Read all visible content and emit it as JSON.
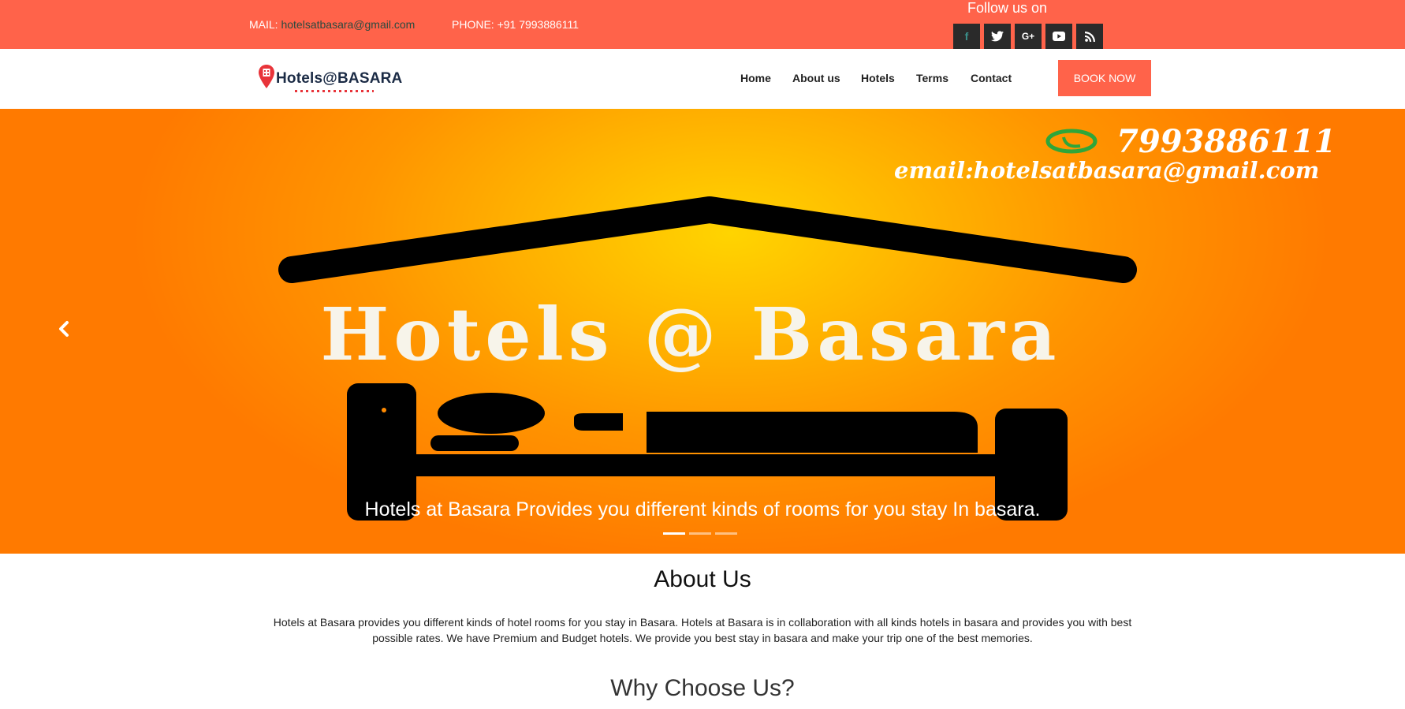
{
  "topbar": {
    "mail_label": "MAIL:",
    "mail_value": "hotelsatbasara@gmail.com",
    "phone_text": "PHONE: +91 7993886111",
    "follow_label": "Follow us on",
    "socials": [
      "facebook-icon",
      "twitter-icon",
      "google-plus-icon",
      "youtube-icon",
      "rss-icon"
    ],
    "socials_glyphs": {
      "facebook": "f",
      "google_plus": "G+"
    }
  },
  "nav": {
    "logo_text": "Hotels@BASARA",
    "items": [
      {
        "label": "Home"
      },
      {
        "label": "About us"
      },
      {
        "label": "Hotels"
      },
      {
        "label": "Terms"
      },
      {
        "label": "Contact"
      }
    ],
    "book_label": "BOOK NOW"
  },
  "hero": {
    "phone_text": "7993886111",
    "email_text": "email:hotelsatbasara@gmail.com",
    "big_title": "Hotels @ Basara",
    "caption": "Hotels at Basara Provides you different kinds of rooms for you stay In basara.",
    "active_slide": 1,
    "slide_count": 3
  },
  "about": {
    "title": "About Us",
    "text": "Hotels at Basara provides you different kinds of hotel rooms for you stay in Basara. Hotels at Basara is in collaboration with all kinds hotels in basara and provides you with best possible rates. We have Premium and Budget hotels. We provide you best stay in basara and make your trip one of the best memories."
  },
  "why": {
    "title": "Why Choose Us?"
  },
  "colors": {
    "accent": "#ff634a",
    "social_bg": "#2a2a2a",
    "whatsapp": "#2fa63a"
  }
}
